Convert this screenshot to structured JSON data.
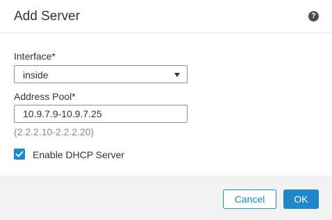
{
  "dialog": {
    "title": "Add Server",
    "help_icon": "?",
    "interface_label": "Interface*",
    "interface_value": "inside",
    "address_pool_label": "Address Pool*",
    "address_pool_value": "10.9.7.9-10.9.7.25",
    "address_pool_hint": "(2.2.2.10-2.2.2.20)",
    "enable_dhcp_label": "Enable DHCP Server",
    "enable_dhcp_checked": true,
    "cancel_label": "Cancel",
    "ok_label": "OK"
  },
  "colors": {
    "accent": "#1e88c8",
    "footer_bg": "#f2f2f2",
    "hint_text": "#8a8a8a"
  },
  "icons": {
    "help": "help-icon",
    "dropdown": "caret-down-icon",
    "checkmark": "checkmark-icon"
  }
}
